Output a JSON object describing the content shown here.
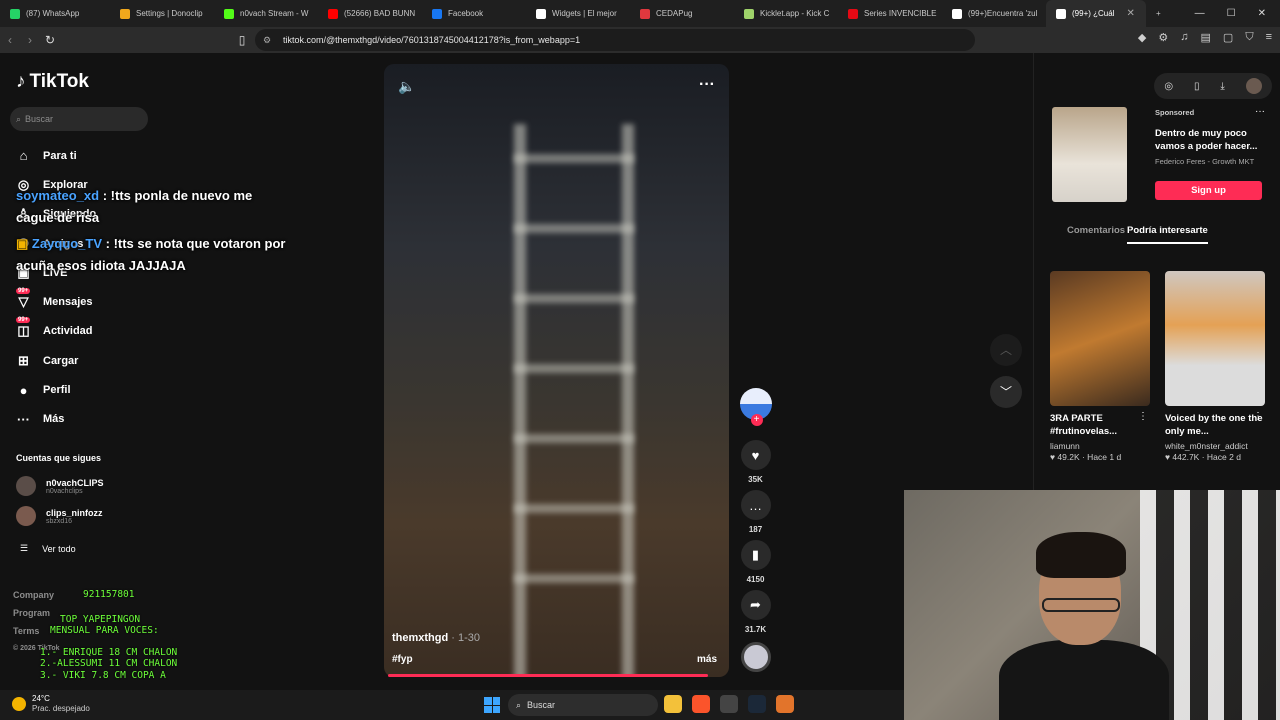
{
  "browser": {
    "tabs": [
      {
        "label": "(87) WhatsApp",
        "color": "#25d366",
        "icon": "whatsapp-icon"
      },
      {
        "label": "Settings | Donoclip",
        "color": "#f1a81c",
        "icon": "donoclip-icon"
      },
      {
        "label": "n0vach Stream - W",
        "color": "#53fc18",
        "icon": "kick-icon"
      },
      {
        "label": "(52666) BAD BUNN",
        "color": "#ff0000",
        "icon": "youtube-icon"
      },
      {
        "label": "Facebook",
        "color": "#1877f2",
        "icon": "facebook-icon"
      },
      {
        "label": "Widgets | El mejor",
        "color": "#ffffff",
        "icon": "widgets-icon"
      },
      {
        "label": "CEDAPug",
        "color": "#e0383e",
        "icon": "cedapug-icon"
      },
      {
        "label": "Kicklet.app - Kick C",
        "color": "#9fd36a",
        "icon": "kicklet-icon"
      },
      {
        "label": "Series INVENCIBLE",
        "color": "#e50914",
        "icon": "series-icon"
      },
      {
        "label": "(99+)Encuentra 'zul",
        "color": "#ffffff",
        "icon": "tiktok-icon"
      },
      {
        "label": "(99+) ¿Cuál",
        "color": "#ffffff",
        "icon": "tiktok-icon",
        "active": true
      }
    ],
    "url": "tiktok.com/@themxthgd/video/7601318745004412178?is_from_webapp=1"
  },
  "sidebar": {
    "logo": "TikTok",
    "search_placeholder": "Buscar",
    "menu": [
      {
        "label": "Para ti",
        "icon": "home-icon",
        "glyph": "⌂"
      },
      {
        "label": "Explorar",
        "icon": "compass-icon",
        "glyph": "◎"
      },
      {
        "label": "Siguiendo",
        "icon": "following-icon",
        "glyph": "♙"
      },
      {
        "label": "Amigos",
        "icon": "friends-icon",
        "glyph": "⚇"
      },
      {
        "label": "LIVE",
        "icon": "live-icon",
        "glyph": "▣"
      },
      {
        "label": "Mensajes",
        "icon": "messages-icon",
        "glyph": "▽",
        "badge": "99+"
      },
      {
        "label": "Actividad",
        "icon": "activity-icon",
        "glyph": "◫",
        "badge": "99+"
      },
      {
        "label": "Cargar",
        "icon": "upload-icon",
        "glyph": "⊞"
      },
      {
        "label": "Perfil",
        "icon": "profile-avatar-icon",
        "glyph": "●"
      },
      {
        "label": "Más",
        "icon": "more-icon",
        "glyph": "···"
      }
    ],
    "following_heading": "Cuentas que sigues",
    "accounts": [
      {
        "name": "n0vachCLIPS",
        "handle": "n0vachclips"
      },
      {
        "name": "clips_ninfozz",
        "handle": "sbzxd16"
      }
    ],
    "see_all": "Ver todo",
    "footer": [
      "Company",
      "Program",
      "Terms",
      "© 2026 TikTok"
    ]
  },
  "chat": [
    {
      "user": "soymateo_xd",
      "message": ": !tts ponla de nuevo me cague de risa"
    },
    {
      "user": "Zayquo_TV",
      "message": ": !tts se nota que votaron por acuña esos idiota JAJJAJA"
    }
  ],
  "donate": {
    "number": "921157801",
    "title": "TOP YAPEPINGON",
    "subtitle": "MENSUAL PARA VOCES:",
    "entries": [
      "1.- ENRIQUE 18 CM CHALON",
      "2.-ALESSUMI 11 CM CHALON",
      "3.- VIKI 7.8 CM COPA A"
    ]
  },
  "video": {
    "author": "themxthgd",
    "date": "· 1-30",
    "tag": "#fyp",
    "more": "más",
    "likes": "35K",
    "comments": "187",
    "saves": "4150",
    "shares": "31.7K",
    "progress": 0.97
  },
  "right": {
    "sponsored": "Sponsored",
    "ad_title": "Dentro de muy poco vamos a poder hacer...",
    "ad_brand": "Federico Feres - Growth MKT",
    "ad_button": "Sign up",
    "tab_comments": "Comentarios",
    "tab_interest": "Podría interesarte",
    "cards": [
      {
        "title": "3RA PARTE #frutinovelas...",
        "user": "liamunn",
        "stats": "♥ 49.2K · Hace 1 d"
      },
      {
        "title": "Voiced by the one the only me...",
        "user": "white_m0nster_addict",
        "stats": "♥ 442.7K · Hace 2 d"
      }
    ]
  },
  "taskbar": {
    "temp": "24°C",
    "weather": "Prac. despejado",
    "search": "Buscar"
  }
}
